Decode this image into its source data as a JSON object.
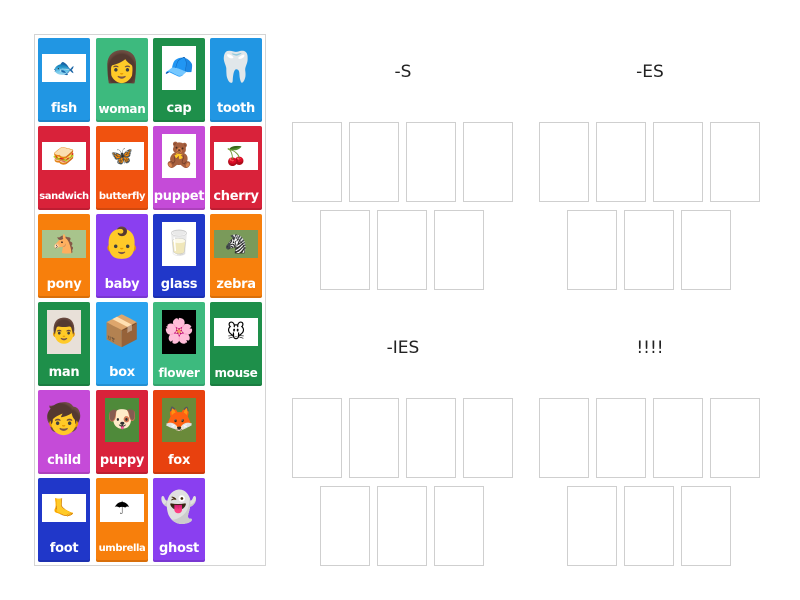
{
  "pool": {
    "cards": [
      {
        "label": "fish",
        "color": "#2196e3",
        "icon": "fish-picture",
        "glyph": "🐟",
        "row": 0,
        "col": 0,
        "size": "normal",
        "photo_bg": "#ffffff"
      },
      {
        "label": "woman",
        "color": "#3dba7e",
        "icon": "woman-picture",
        "glyph": "👩",
        "row": 0,
        "col": 1,
        "size": "mid",
        "photo_bg": "none"
      },
      {
        "label": "cap",
        "color": "#1e8f4a",
        "icon": "cap-picture",
        "glyph": "🧢",
        "row": 0,
        "col": 2,
        "size": "normal",
        "photo_bg": "#ffffff"
      },
      {
        "label": "tooth",
        "color": "#2196e3",
        "icon": "tooth-picture",
        "glyph": "🦷",
        "row": 0,
        "col": 3,
        "size": "normal",
        "photo_bg": "none"
      },
      {
        "label": "sandwich",
        "color": "#d9223a",
        "icon": "sandwich-picture",
        "glyph": "🥪",
        "row": 1,
        "col": 0,
        "size": "small",
        "photo_bg": "#ffffff"
      },
      {
        "label": "butterfly",
        "color": "#f0520f",
        "icon": "butterfly-picture",
        "glyph": "🦋",
        "row": 1,
        "col": 1,
        "size": "small",
        "photo_bg": "#ffffff"
      },
      {
        "label": "puppet",
        "color": "#c54bd8",
        "icon": "puppet-picture",
        "glyph": "🧸",
        "row": 1,
        "col": 2,
        "size": "normal",
        "photo_bg": "#ffffff"
      },
      {
        "label": "cherry",
        "color": "#d9223a",
        "icon": "cherry-picture",
        "glyph": "🍒",
        "row": 1,
        "col": 3,
        "size": "normal",
        "photo_bg": "#ffffff"
      },
      {
        "label": "pony",
        "color": "#f77f0c",
        "icon": "pony-picture",
        "glyph": "🐴",
        "row": 2,
        "col": 0,
        "size": "normal",
        "photo_bg": "#a8c48c"
      },
      {
        "label": "baby",
        "color": "#8a3ff0",
        "icon": "baby-picture",
        "glyph": "👶",
        "row": 2,
        "col": 1,
        "size": "normal",
        "photo_bg": "none"
      },
      {
        "label": "glass",
        "color": "#2037c9",
        "icon": "glass-picture",
        "glyph": "🥛",
        "row": 2,
        "col": 2,
        "size": "normal",
        "photo_bg": "#ffffff"
      },
      {
        "label": "zebra",
        "color": "#f77f0c",
        "icon": "zebra-picture",
        "glyph": "🦓",
        "row": 2,
        "col": 3,
        "size": "normal",
        "photo_bg": "#7a9a5a"
      },
      {
        "label": "man",
        "color": "#1e8f4a",
        "icon": "man-picture",
        "glyph": "👨",
        "row": 3,
        "col": 0,
        "size": "normal",
        "photo_bg": "#e8e0d8"
      },
      {
        "label": "box",
        "color": "#2aa3ee",
        "icon": "box-picture",
        "glyph": "📦",
        "row": 3,
        "col": 1,
        "size": "normal",
        "photo_bg": "none"
      },
      {
        "label": "flower",
        "color": "#3dba7e",
        "icon": "flower-picture",
        "glyph": "🌸",
        "row": 3,
        "col": 2,
        "size": "mid",
        "photo_bg": "#000000"
      },
      {
        "label": "mouse",
        "color": "#1e8f4a",
        "icon": "mouse-picture",
        "glyph": "🐭",
        "row": 3,
        "col": 3,
        "size": "mid",
        "photo_bg": "#ffffff"
      },
      {
        "label": "child",
        "color": "#c54bd8",
        "icon": "child-picture",
        "glyph": "🧒",
        "row": 4,
        "col": 0,
        "size": "normal",
        "photo_bg": "none"
      },
      {
        "label": "puppy",
        "color": "#d9223a",
        "icon": "puppy-picture",
        "glyph": "🐶",
        "row": 4,
        "col": 1,
        "size": "normal",
        "photo_bg": "#4f8a3a"
      },
      {
        "label": "fox",
        "color": "#e8410e",
        "icon": "fox-picture",
        "glyph": "🦊",
        "row": 4,
        "col": 2,
        "size": "normal",
        "photo_bg": "#6a8a3a"
      },
      {
        "label": "foot",
        "color": "#2037c9",
        "icon": "foot-picture",
        "glyph": "🦶",
        "row": 5,
        "col": 0,
        "size": "normal",
        "photo_bg": "#ffffff"
      },
      {
        "label": "umbrella",
        "color": "#f77f0c",
        "icon": "umbrella-picture",
        "glyph": "☂",
        "row": 5,
        "col": 1,
        "size": "small",
        "photo_bg": "#ffffff"
      },
      {
        "label": "ghost",
        "color": "#8a3ff0",
        "icon": "ghost-picture",
        "glyph": "👻",
        "row": 5,
        "col": 2,
        "size": "normal",
        "photo_bg": "none"
      }
    ]
  },
  "groups": [
    {
      "title": "-S",
      "slots": 7
    },
    {
      "title": "-ES",
      "slots": 7
    },
    {
      "title": "-IES",
      "slots": 7
    },
    {
      "title": "!!!!",
      "slots": 7
    }
  ]
}
